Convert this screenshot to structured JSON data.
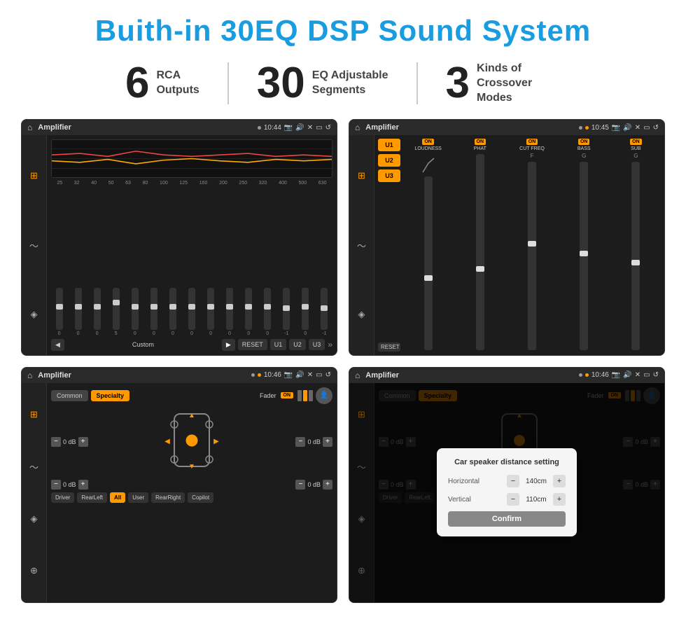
{
  "title": "Buith-in 30EQ DSP Sound System",
  "stats": [
    {
      "number": "6",
      "label": "RCA\nOutputs"
    },
    {
      "number": "30",
      "label": "EQ Adjustable\nSegments"
    },
    {
      "number": "3",
      "label": "Kinds of\nCrossover Modes"
    }
  ],
  "screens": [
    {
      "id": "screen1",
      "status_bar": {
        "title": "Amplifier",
        "time": "10:44"
      },
      "type": "eq"
    },
    {
      "id": "screen2",
      "status_bar": {
        "title": "Amplifier",
        "time": "10:45"
      },
      "type": "amp2"
    },
    {
      "id": "screen3",
      "status_bar": {
        "title": "Amplifier",
        "time": "10:46"
      },
      "type": "spk"
    },
    {
      "id": "screen4",
      "status_bar": {
        "title": "Amplifier",
        "time": "10:46"
      },
      "type": "spk-dialog"
    }
  ],
  "eq": {
    "freq_labels": [
      "25",
      "32",
      "40",
      "50",
      "63",
      "80",
      "100",
      "125",
      "160",
      "200",
      "250",
      "320",
      "400",
      "500",
      "630"
    ],
    "values": [
      "0",
      "0",
      "0",
      "5",
      "0",
      "0",
      "0",
      "0",
      "0",
      "0",
      "0",
      "0",
      "-1",
      "0",
      "-1"
    ],
    "preset": "Custom",
    "buttons": [
      "RESET",
      "U1",
      "U2",
      "U3"
    ]
  },
  "amp2": {
    "presets": [
      "U1",
      "U2",
      "U3"
    ],
    "controls": [
      "LOUDNESS",
      "PHAT",
      "CUT FREQ",
      "BASS",
      "SUB"
    ],
    "reset": "RESET"
  },
  "spk": {
    "tabs": [
      "Common",
      "Specialty"
    ],
    "fader_label": "Fader",
    "fader_on": "ON",
    "levels": [
      "0 dB",
      "0 dB",
      "0 dB",
      "0 dB"
    ],
    "bottom_btns": [
      "Driver",
      "RearLeft",
      "All",
      "User",
      "RearRight",
      "Copilot"
    ]
  },
  "dialog": {
    "title": "Car speaker distance setting",
    "horizontal_label": "Horizontal",
    "horizontal_value": "140cm",
    "vertical_label": "Vertical",
    "vertical_value": "110cm",
    "confirm_label": "Confirm"
  }
}
